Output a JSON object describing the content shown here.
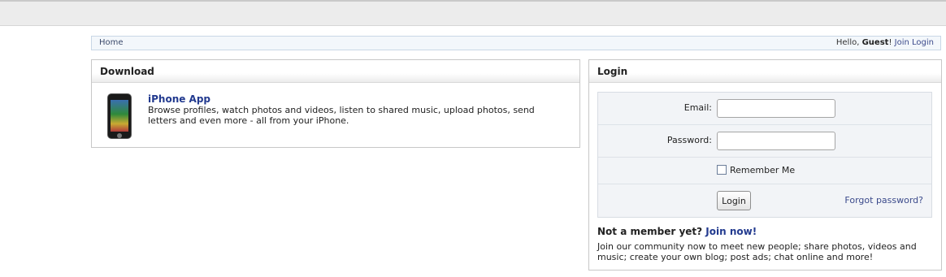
{
  "breadcrumb": {
    "home": "Home",
    "greeting": "Hello, ",
    "user": "Guest",
    "exclaim": "!",
    "join": "Join",
    "login": "Login"
  },
  "download": {
    "title": "Download",
    "app_title": "iPhone App",
    "app_desc": "Browse profiles, watch photos and videos, listen to shared music, upload photos, send letters and even more - all from your iPhone."
  },
  "login": {
    "title": "Login",
    "email_label": "Email:",
    "email_value": "",
    "password_label": "Password:",
    "password_value": "",
    "remember_label": "Remember Me",
    "remember_checked": false,
    "submit_label": "Login",
    "forgot_label": "Forgot password?",
    "not_member_text": "Not a member yet?",
    "join_now": "Join now!",
    "join_desc": "Join our community now to meet new people; share photos, videos and music; create your own blog; post ads; chat online and more!"
  },
  "icons": {
    "app_image": "iphone-icon",
    "checkbox": "checkbox-icon"
  }
}
